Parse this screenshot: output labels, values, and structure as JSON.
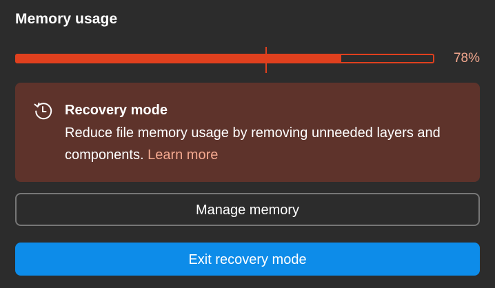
{
  "header": {
    "title": "Memory usage"
  },
  "memory": {
    "usage_fraction": 0.78,
    "marker_fraction": 0.6,
    "percent_label": "78%",
    "color": "#e0401e"
  },
  "callout": {
    "icon": "restore-clock-icon",
    "title": "Recovery mode",
    "body": "Reduce file memory usage by removing unneeded layers and components.",
    "link_label": "Learn more",
    "background": "#5e332b",
    "link_color": "#f4a88f"
  },
  "actions": {
    "manage_label": "Manage memory",
    "exit_label": "Exit recovery mode",
    "primary_color": "#0d8ce9"
  }
}
